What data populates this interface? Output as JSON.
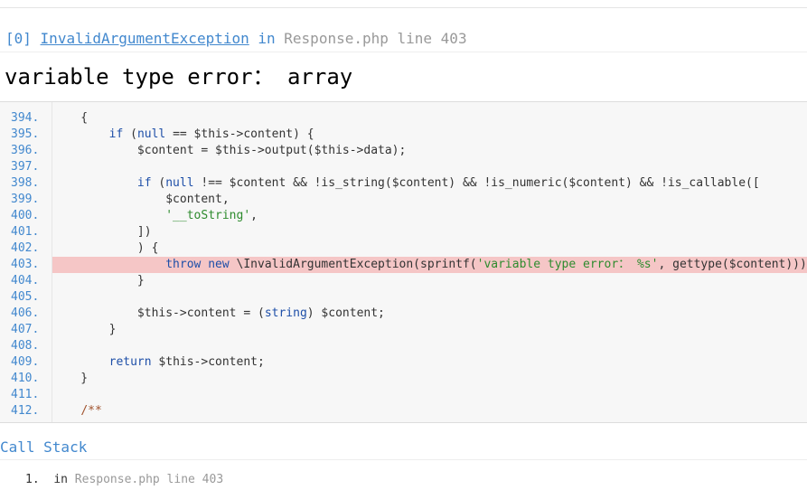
{
  "exception": {
    "index": "[0]",
    "class_name": "InvalidArgumentException",
    "in_word": "in",
    "location": "Response.php line 403"
  },
  "error_message": "variable type error： array",
  "code": {
    "highlight_line": "403.",
    "lines": [
      {
        "num": "394.",
        "text": "    {"
      },
      {
        "num": "395.",
        "text": "        if (null == $this->content) {"
      },
      {
        "num": "396.",
        "text": "            $content = $this->output($this->data);"
      },
      {
        "num": "397.",
        "text": ""
      },
      {
        "num": "398.",
        "text": "            if (null !== $content && !is_string($content) && !is_numeric($content) && !is_callable(["
      },
      {
        "num": "399.",
        "text": "                $content,"
      },
      {
        "num": "400.",
        "text": "                '__toString',"
      },
      {
        "num": "401.",
        "text": "            ])"
      },
      {
        "num": "402.",
        "text": "            ) {"
      },
      {
        "num": "403.",
        "text": "                throw new \\InvalidArgumentException(sprintf('variable type error： %s', gettype($content)));"
      },
      {
        "num": "404.",
        "text": "            }"
      },
      {
        "num": "405.",
        "text": ""
      },
      {
        "num": "406.",
        "text": "            $this->content = (string) $content;"
      },
      {
        "num": "407.",
        "text": "        }"
      },
      {
        "num": "408.",
        "text": ""
      },
      {
        "num": "409.",
        "text": "        return $this->content;"
      },
      {
        "num": "410.",
        "text": "    }"
      },
      {
        "num": "411.",
        "text": ""
      },
      {
        "num": "412.",
        "text": "    /**"
      }
    ]
  },
  "call_stack": {
    "title": "Call Stack",
    "items": [
      {
        "num": "1.",
        "in_word": "in",
        "location": "Response.php line 403"
      }
    ]
  },
  "colors": {
    "link_blue": "#4288ce",
    "highlight_red": "#f5c6c6",
    "muted_gray": "#999999"
  }
}
